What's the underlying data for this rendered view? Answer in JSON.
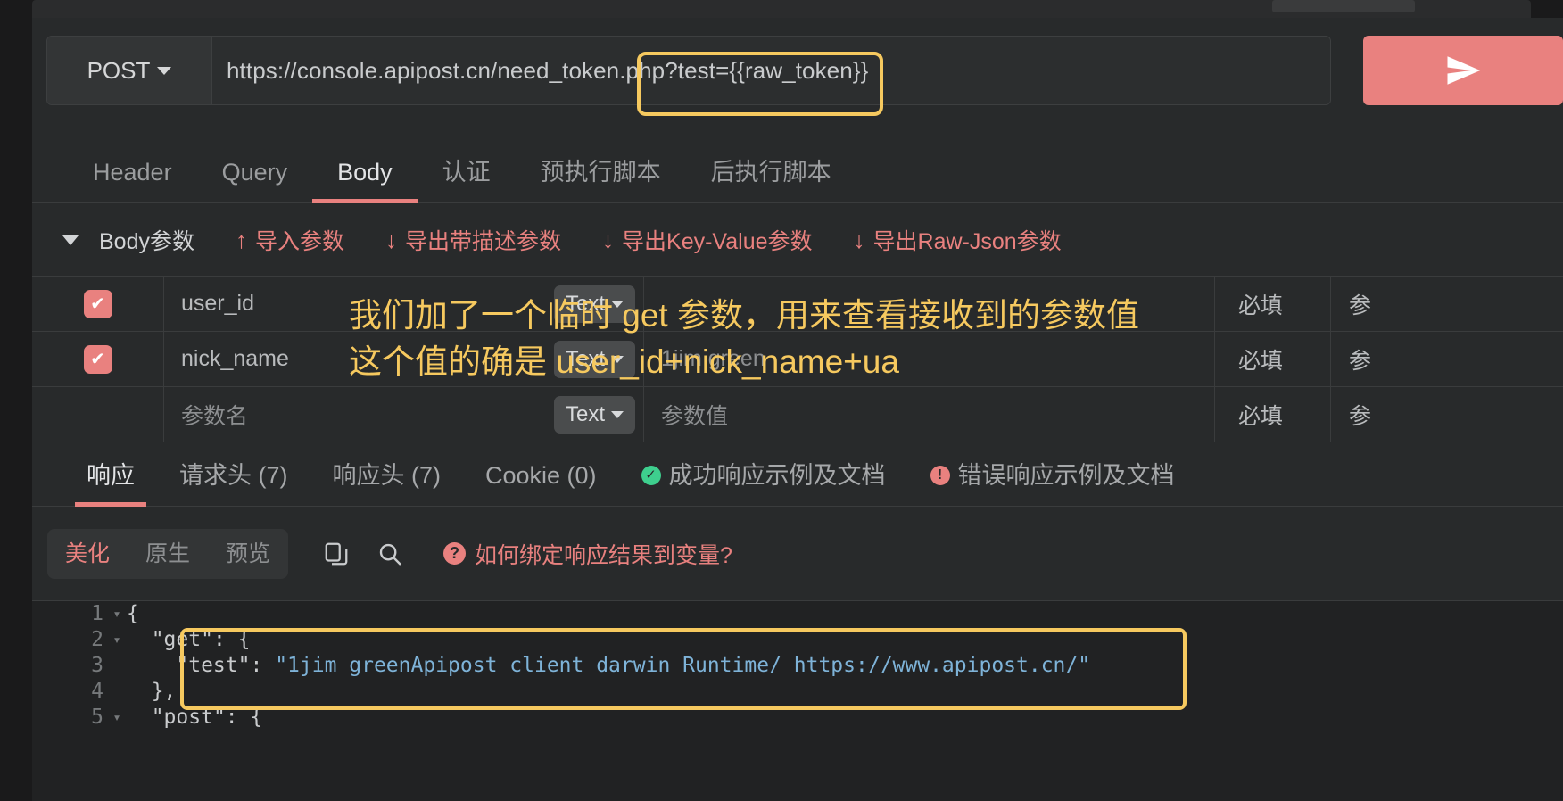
{
  "request": {
    "method": "POST",
    "method_caret": "chevron-down",
    "url": "https://console.apipost.cn/need_token.php?test={{raw_token}}",
    "send_icon": "send-plane-icon"
  },
  "request_tabs": [
    {
      "label": "Header",
      "active": false
    },
    {
      "label": "Query",
      "active": false
    },
    {
      "label": "Body",
      "active": true
    },
    {
      "label": "认证",
      "active": false
    },
    {
      "label": "预执行脚本",
      "active": false
    },
    {
      "label": "后执行脚本",
      "active": false
    }
  ],
  "body_toolbar": {
    "title": "Body参数",
    "actions": [
      {
        "icon": "arrow-up-icon",
        "glyph": "↑",
        "label": "导入参数"
      },
      {
        "icon": "arrow-down-icon",
        "glyph": "↓",
        "label": "导出带描述参数"
      },
      {
        "icon": "arrow-down-icon",
        "glyph": "↓",
        "label": "导出Key-Value参数"
      },
      {
        "icon": "arrow-down-icon",
        "glyph": "↓",
        "label": "导出Raw-Json参数"
      }
    ]
  },
  "param_table": {
    "type_label": "Text",
    "rows": [
      {
        "checked": true,
        "name": "user_id",
        "name_placeholder": "",
        "type": "Text",
        "value": "",
        "value_placeholder": "",
        "required": "必填",
        "tail": "参"
      },
      {
        "checked": true,
        "name": "nick_name",
        "name_placeholder": "",
        "type": "Text",
        "value": "1jim green",
        "value_placeholder": "",
        "required": "必填",
        "tail": "参"
      },
      {
        "checked": false,
        "name": "",
        "name_placeholder": "参数名",
        "type": "Text",
        "value": "",
        "value_placeholder": "参数值",
        "required": "必填",
        "tail": "参"
      }
    ]
  },
  "annotations": {
    "url_box": "highlight-box",
    "overlay_line1": "我们加了一个临时 get 参数，用来查看接收到的参数值",
    "overlay_line2": "这个值的确是 user_id+nick_name+ua",
    "json_box": "highlight-box",
    "color": "#f6c95f"
  },
  "response_tabs": [
    {
      "label": "响应",
      "active": true,
      "icon": ""
    },
    {
      "label": "请求头 (7)",
      "active": false,
      "icon": ""
    },
    {
      "label": "响应头 (7)",
      "active": false,
      "icon": ""
    },
    {
      "label": "Cookie (0)",
      "active": false,
      "icon": ""
    },
    {
      "label": "成功响应示例及文档",
      "active": false,
      "icon": "check-circle-icon"
    },
    {
      "label": "错误响应示例及文档",
      "active": false,
      "icon": "error-circle-icon"
    }
  ],
  "viewer_toolbar": {
    "segments": [
      {
        "label": "美化",
        "active": true
      },
      {
        "label": "原生",
        "active": false
      },
      {
        "label": "预览",
        "active": false
      }
    ],
    "copy_icon": "copy-icon",
    "search_icon": "search-icon",
    "hint": "如何绑定响应结果到变量?"
  },
  "code": {
    "lines": [
      {
        "num": "1",
        "fold": "▾",
        "indent": 0,
        "parts": [
          {
            "t": "punc",
            "v": "{"
          }
        ]
      },
      {
        "num": "2",
        "fold": "▾",
        "indent": 1,
        "parts": [
          {
            "t": "key",
            "v": "\"get\""
          },
          {
            "t": "punc",
            "v": ": {"
          }
        ]
      },
      {
        "num": "3",
        "fold": "",
        "indent": 2,
        "parts": [
          {
            "t": "key",
            "v": "\"test\""
          },
          {
            "t": "punc",
            "v": ": "
          },
          {
            "t": "str",
            "v": "\"1jim greenApipost client darwin Runtime/ https://www.apipost.cn/\""
          }
        ]
      },
      {
        "num": "4",
        "fold": "",
        "indent": 1,
        "parts": [
          {
            "t": "punc",
            "v": "},"
          }
        ]
      },
      {
        "num": "5",
        "fold": "▾",
        "indent": 1,
        "parts": [
          {
            "t": "key",
            "v": "\"post\""
          },
          {
            "t": "punc",
            "v": ": {"
          }
        ]
      }
    ]
  },
  "colors": {
    "accent": "#e9817f",
    "annotation": "#f6c95f",
    "panel_bg": "#282a2b",
    "editor_bg": "#212223",
    "success": "#3ecf8e"
  }
}
